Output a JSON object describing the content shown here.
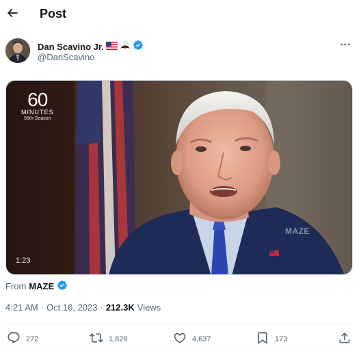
{
  "header": {
    "title": "Post",
    "back_icon": "arrow-left-icon"
  },
  "author": {
    "display_name": "Dan Scavino Jr.",
    "name_emojis": [
      "us-flag-icon",
      "eagle-icon"
    ],
    "verified_icon": "verified-badge-icon",
    "handle": "@DanScavino",
    "more_icon": "more-horizontal-icon"
  },
  "media": {
    "duration": "1:23",
    "logo_number": "60",
    "logo_word": "MINUTES",
    "logo_season": "56th Season",
    "watermark": "MAZE"
  },
  "source": {
    "prefix": "From",
    "name": "MAZE"
  },
  "meta": {
    "time": "4:21 AM",
    "separator1": "·",
    "date": "Oct 16, 2023",
    "separator2": "·",
    "views_count": "212.3K",
    "views_label": "Views"
  },
  "actions": {
    "replies": "272",
    "reposts": "1,828",
    "likes": "4,637",
    "bookmarks": "173"
  },
  "colors": {
    "text_primary": "#0f1419",
    "text_secondary": "#536471",
    "verified_blue": "#1d9bf0",
    "divider": "#eff3f4"
  }
}
